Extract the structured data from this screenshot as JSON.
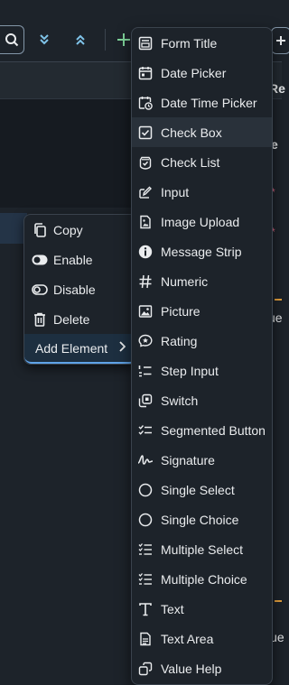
{
  "toolbar": {
    "icons": [
      "search-icon",
      "double-chevron-down-icon",
      "double-chevron-up-icon",
      "plus-icon"
    ],
    "right_text_1": "Re",
    "right_text_2": "e"
  },
  "background": {
    "right_fragment": "ue",
    "right_fragment_bottom": "lue"
  },
  "context_menu": {
    "items": [
      {
        "label": "Copy",
        "icon": "copy-icon"
      },
      {
        "label": "Enable",
        "icon": "toggle-on-icon"
      },
      {
        "label": "Disable",
        "icon": "toggle-off-icon"
      },
      {
        "label": "Delete",
        "icon": "trash-icon"
      },
      {
        "label": "Add Element",
        "icon": "chevron-right-icon"
      }
    ]
  },
  "submenu": {
    "items": [
      {
        "label": "Form Title",
        "icon": "form-title-icon"
      },
      {
        "label": "Date Picker",
        "icon": "calendar-icon"
      },
      {
        "label": "Date Time Picker",
        "icon": "calendar-clock-icon"
      },
      {
        "label": "Check Box",
        "icon": "checkbox-icon"
      },
      {
        "label": "Check List",
        "icon": "checklist-icon"
      },
      {
        "label": "Input",
        "icon": "input-edit-icon"
      },
      {
        "label": "Image Upload",
        "icon": "image-upload-icon"
      },
      {
        "label": "Message Strip",
        "icon": "info-icon"
      },
      {
        "label": "Numeric",
        "icon": "hash-icon"
      },
      {
        "label": "Picture",
        "icon": "picture-icon"
      },
      {
        "label": "Rating",
        "icon": "rating-icon"
      },
      {
        "label": "Step Input",
        "icon": "step-input-icon"
      },
      {
        "label": "Switch",
        "icon": "switch-icon"
      },
      {
        "label": "Segmented Button",
        "icon": "segmented-button-icon"
      },
      {
        "label": "Signature",
        "icon": "signature-icon"
      },
      {
        "label": "Single Select",
        "icon": "radio-icon"
      },
      {
        "label": "Single Choice",
        "icon": "radio-icon"
      },
      {
        "label": "Multiple Select",
        "icon": "multi-list-icon"
      },
      {
        "label": "Multiple Choice",
        "icon": "multi-list-icon"
      },
      {
        "label": "Text",
        "icon": "text-icon"
      },
      {
        "label": "Text Area",
        "icon": "text-area-icon"
      },
      {
        "label": "Value Help",
        "icon": "value-help-icon"
      }
    ],
    "hovered_index": 3
  },
  "colors": {
    "background": "#1d232a",
    "accent": "#5fa3e8",
    "text": "#eaecee",
    "required": "#e86a8a",
    "highlight": "#e8a33e"
  }
}
